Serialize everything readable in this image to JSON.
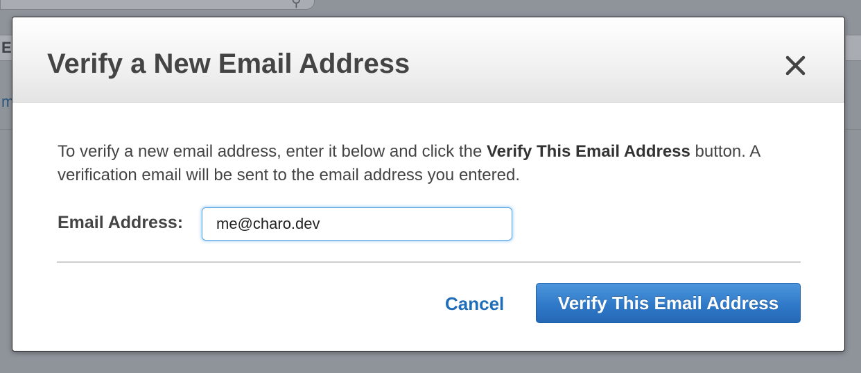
{
  "backdrop": {
    "left_letter": "E",
    "left_link_fragment": "m",
    "search_icon": "search-icon"
  },
  "modal": {
    "title": "Verify a New Email Address",
    "close_icon": "close-icon",
    "description_prefix": "To verify a new email address, enter it below and click the ",
    "description_bold": "Verify This Email Address",
    "description_suffix": " button. A verification email will be sent to the email address you entered.",
    "email_label": "Email Address:",
    "email_value": "me@charo.dev",
    "cancel_label": "Cancel",
    "verify_label": "Verify This Email Address"
  },
  "colors": {
    "overlay": "#8f949b",
    "title_text": "#444444",
    "link_blue": "#1f6db8",
    "button_blue": "#2f79c9",
    "input_focus": "#5ea7e3"
  }
}
